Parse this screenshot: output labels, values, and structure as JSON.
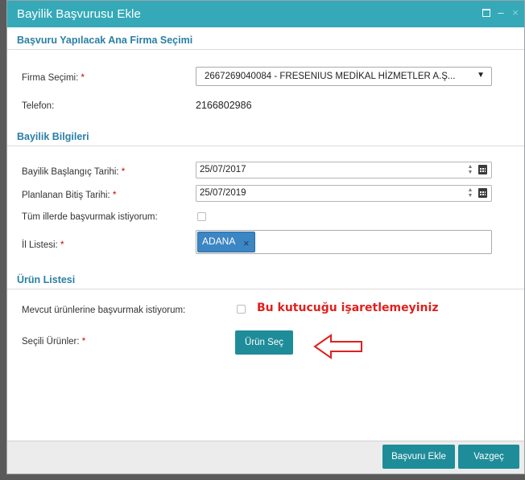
{
  "window": {
    "title": "Bayilik Başvurusu Ekle",
    "minimize_glyph": "–",
    "close_glyph": "×"
  },
  "section_firm": {
    "header": "Başvuru Yapılacak Ana Firma Seçimi",
    "firm_label": "Firma Seçimi:",
    "firm_selected": "2667269040084 - FRESENIUS MEDİKAL HİZMETLER A.Ş...",
    "phone_label": "Telefon:",
    "phone_value": "2166802986"
  },
  "section_dealer": {
    "header": "Bayilik Bilgileri",
    "start_label": "Bayilik Başlangıç Tarihi:",
    "start_value": "25/07/2017",
    "end_label": "Planlanan Bitiş Tarihi:",
    "end_value": "25/07/2019",
    "all_provinces_label": "Tüm illerde başvurmak istiyorum:",
    "province_list_label": "İl Listesi:",
    "province_tags": [
      "ADANA"
    ],
    "tag_remove_glyph": "×"
  },
  "section_products": {
    "header": "Ürün Listesi",
    "existing_label": "Mevcut ürünlerine başvurmak istiyorum:",
    "warning_text": "Bu kutucuğu işaretlemeyiniz",
    "selected_label": "Seçili Ürünler:",
    "select_button": "Ürün Seç"
  },
  "footer": {
    "submit_button": "Başvuru Ekle",
    "cancel_button": "Vazgeç"
  },
  "required_marker": "*",
  "spinner_glyphs": {
    "up": "▲",
    "down": "▼"
  },
  "dropdown_glyph": "▼",
  "icons": {
    "calendar": "calendar-icon",
    "dropdown": "chevron-down-icon",
    "annotation_arrow": "arrow-left-icon"
  },
  "colors": {
    "titlebar": "#35a9b8",
    "section_header_text": "#2a7fa6",
    "primary_button": "#1f8c99",
    "tag": "#3c86c4",
    "warning": "#e0201c",
    "required": "#d00000"
  }
}
